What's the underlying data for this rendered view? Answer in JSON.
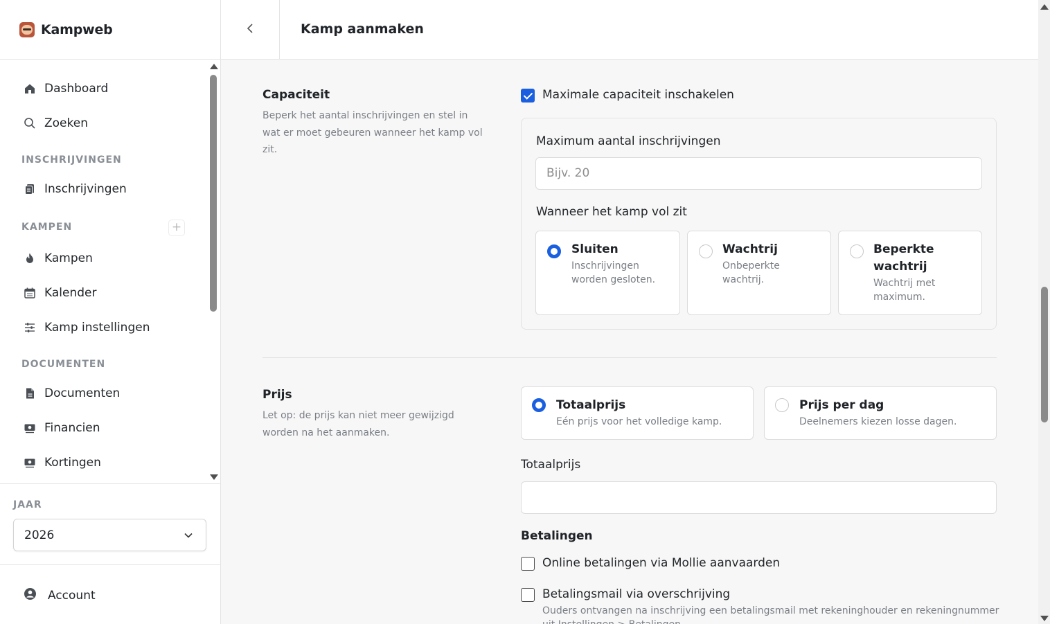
{
  "app": {
    "name": "Kampweb"
  },
  "header": {
    "title": "Kamp aanmaken"
  },
  "sidebar": {
    "items_top": [
      {
        "label": "Dashboard",
        "icon": "home-icon"
      },
      {
        "label": "Zoeken",
        "icon": "search-icon"
      }
    ],
    "sections": {
      "inschrijvingen": "INSCHRIJVINGEN",
      "kampen": "KAMPEN",
      "documenten": "DOCUMENTEN"
    },
    "items": {
      "inschrijvingen": "Inschrijvingen",
      "kampen": "Kampen",
      "kalender": "Kalender",
      "kamp_instellingen": "Kamp instellingen",
      "documenten": "Documenten",
      "financien": "Financien",
      "kortingen": "Kortingen"
    },
    "add_symbol": "+",
    "year_label": "JAAR",
    "year_value": "2026",
    "account": "Account"
  },
  "capaciteit": {
    "title": "Capaciteit",
    "description": "Beperk het aantal inschrijvingen en stel in wat er moet gebeuren wanneer het kamp vol zit.",
    "enable_label": "Maximale capaciteit inschakelen",
    "enable_checked": true,
    "max_label": "Maximum aantal inschrijvingen",
    "max_placeholder": "Bijv. 20",
    "full_label": "Wanneer het kamp vol zit",
    "options": [
      {
        "title": "Sluiten",
        "desc": "Inschrijvingen worden gesloten.",
        "selected": true
      },
      {
        "title": "Wachtrij",
        "desc": "Onbeperkte wachtrij.",
        "selected": false
      },
      {
        "title": "Beperkte wachtrij",
        "desc": "Wachtrij met maximum.",
        "selected": false
      }
    ]
  },
  "prijs": {
    "title": "Prijs",
    "description": "Let op: de prijs kan niet meer gewijzigd worden na het aanmaken.",
    "options": [
      {
        "title": "Totaalprijs",
        "desc": "Eén prijs voor het volledige kamp.",
        "selected": true
      },
      {
        "title": "Prijs per dag",
        "desc": "Deelnemers kiezen losse dagen.",
        "selected": false
      }
    ],
    "total_label": "Totaalprijs",
    "total_value": "",
    "payments_heading": "Betalingen",
    "mollie_label": "Online betalingen via Mollie aanvaarden",
    "mollie_checked": false,
    "transfer_label": "Betalingsmail via overschrijving",
    "transfer_checked": false,
    "transfer_hint": "Ouders ontvangen na inschrijving een betalingsmail met rekeninghouder en rekeningnummer uit Instellingen > Betalingen."
  },
  "colors": {
    "accent": "#1a5fe0"
  }
}
